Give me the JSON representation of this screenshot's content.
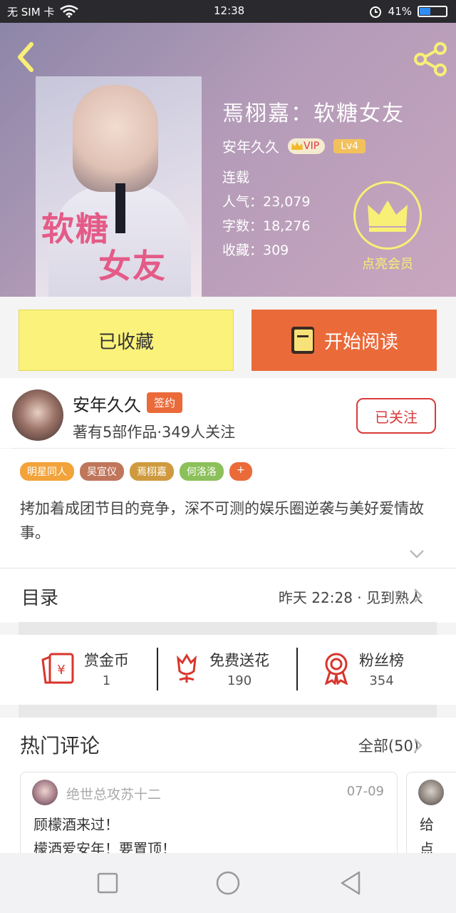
{
  "status": {
    "sim": "无 SIM 卡",
    "time": "12:38",
    "battery": "41%",
    "battery_level": 0.41
  },
  "book": {
    "title": "焉栩嘉：软糖女友",
    "author": "安年久久",
    "vip_label": "VIP",
    "level": "Lv4",
    "status": "连载",
    "popularity": "人气：23,079",
    "words": "字数：18,276",
    "favorites": "收藏：309",
    "member_label": "点亮会员",
    "cover_title_line1": "软糖",
    "cover_title_line2": "女友"
  },
  "actions": {
    "collected": "已收藏",
    "start_read": "开始阅读"
  },
  "author": {
    "name": "安年久久",
    "badge": "签约",
    "stats": "著有5部作品·349人关注",
    "follow": "已关注"
  },
  "tags": [
    {
      "label": "明星同人",
      "color": "#f2a33a"
    },
    {
      "label": "吴宣仪",
      "color": "#c0765a"
    },
    {
      "label": "焉栩嘉",
      "color": "#cf9a3e"
    },
    {
      "label": "何洛洛",
      "color": "#8cc05a"
    },
    {
      "label": "+",
      "color": "#ea6a3a"
    }
  ],
  "description": "拷加着成团节目的竞争，深不可测的娱乐圈逆袭与美好爱情故事。",
  "toc": {
    "label": "目录",
    "latest": "昨天 22:28 · 见到熟人"
  },
  "stats": [
    {
      "label": "赏金币",
      "value": "1",
      "icon": "red-envelope-icon"
    },
    {
      "label": "免费送花",
      "value": "190",
      "icon": "flower-icon"
    },
    {
      "label": "粉丝榜",
      "value": "354",
      "icon": "ribbon-medal-icon"
    }
  ],
  "comments": {
    "title": "热门评论",
    "all": "全部(50)",
    "items": [
      {
        "user": "绝世总攻苏十二",
        "date": "07-09",
        "lines": [
          "顾檬酒来过！",
          "檬酒爱安年！要置顶！"
        ]
      },
      {
        "user": "",
        "date": "",
        "lines": [
          "给",
          "点"
        ]
      }
    ]
  },
  "colors": {
    "accent_orange": "#ea6a3a",
    "collected_yellow": "#fbf27b",
    "follow_red": "#d93a3a",
    "member_yellow": "#f8ef76"
  }
}
